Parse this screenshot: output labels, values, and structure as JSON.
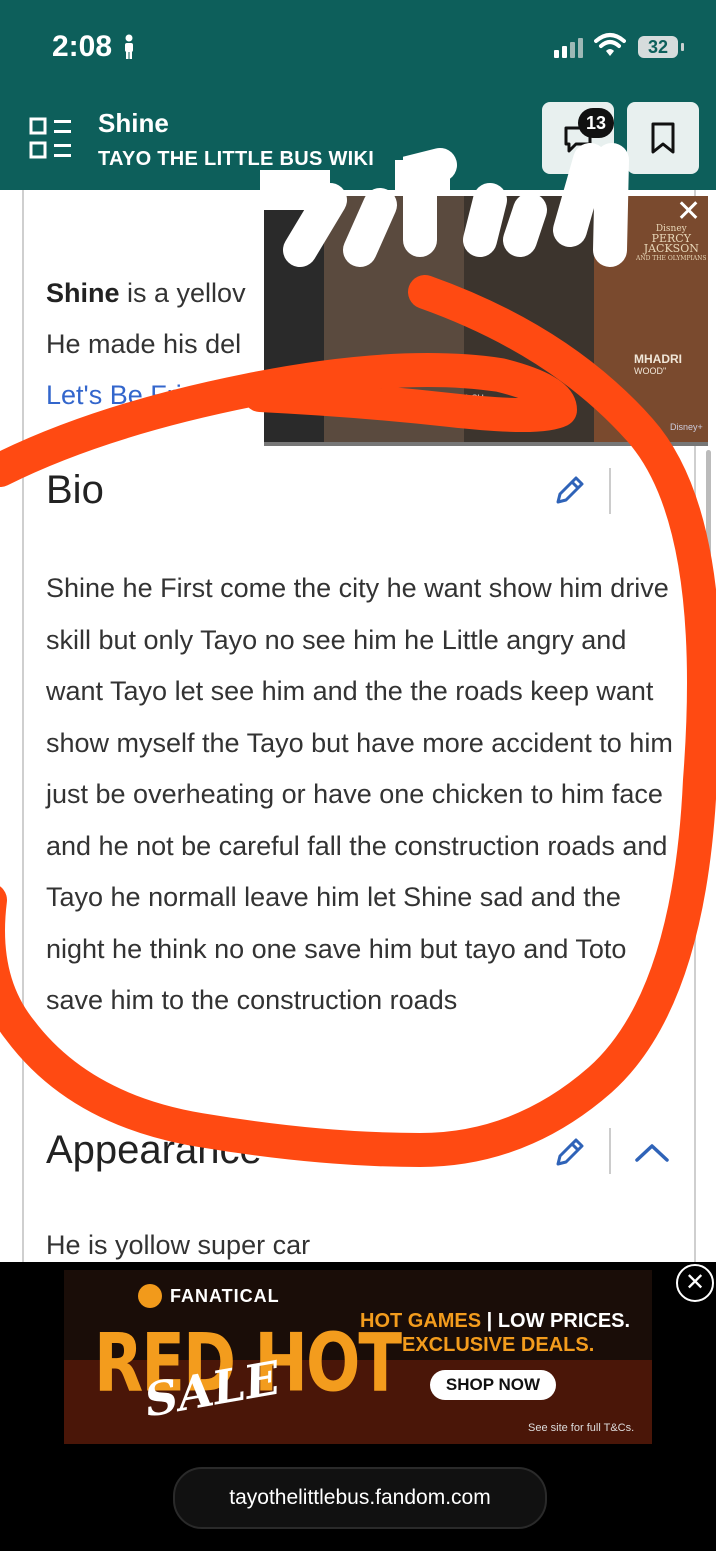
{
  "status_bar": {
    "time": "2:08",
    "battery": "32"
  },
  "header": {
    "title": "Shine",
    "wiki": "TAYO THE LITTLE BUS WIKI",
    "comments_count": "13"
  },
  "intro": {
    "name_bold": "Shine",
    "line1_rest": " is a yellov",
    "line2": "He made his del",
    "link": "Let's Be Frie"
  },
  "video_ad": {
    "caption_annabeth": "\"ANNABETH CH",
    "brand": "Disney",
    "title_line1": "PERCY",
    "title_line2": "JACKSON",
    "title_line3": "AND THE OLYMPIANS",
    "caption_mhadri": "MHADRI",
    "caption_wood": "WOOD\"",
    "service": "Disney+"
  },
  "sections": [
    {
      "heading": "Bio",
      "text": "Shine he First come the city he want show him drive skill but only Tayo no see him he Little angry and want Tayo let see him and the the roads keep want show myself the Tayo but have more accident to him just be overheating or have one chicken to him face and he not be careful fall the construction roads and Tayo he normall leave him let Shine sad and the night he think no one save him but tayo and Toto save him to the construction roads"
    },
    {
      "heading": "Appearance",
      "text": "He is yollow super car"
    }
  ],
  "banner_ad": {
    "brand": "FANATICAL",
    "headline": "RED HOT",
    "sale": "SALE",
    "tag_a": "HOT GAMES",
    "tag_b": " | LOW PRICES.",
    "tag_c": "EXCLUSIVE DEALS.",
    "cta": "SHOP NOW",
    "terms": "See site for full T&Cs."
  },
  "browser": {
    "url": "tayothelittlebus.fandom.com"
  },
  "colors": {
    "header_bg": "#0d5f5b",
    "link": "#3366cc",
    "annotation": "#ff4a12"
  }
}
